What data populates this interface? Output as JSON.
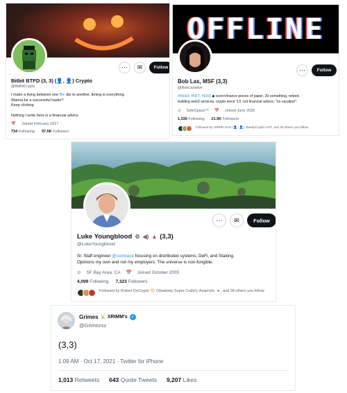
{
  "card1": {
    "name": "Bitbit BTFD (3, 3) (👤, 👤) Crypto",
    "handle": "@BitBitCrypto",
    "bio_lines": [
      "I make a living between one ",
      "Btc",
      " dip to another, timing is everything.",
      "Wanna be a successful trader?",
      "Keep clicking.",
      "-",
      "Nothing I write here is a financial advice"
    ],
    "joined": "Joined February 2017",
    "following_count": "734",
    "following_label": "Following",
    "followers_count": "97.5K",
    "followers_label": "Followers",
    "follow_label": "Follow",
    "more_icon": "more-icon"
  },
  "card2": {
    "banner_text": "OFFLINE",
    "name": "Bob Lax, MSF (3,3)",
    "handle": "@BobLaxative",
    "bio_tags": "#Web3, #NFT, #ENS",
    "bio_line1_rest": " econ+finance pieces of paper, 20-something, retired,",
    "bio_line2": "building web3 services. crypto since '13. not financial advice, \"on vacation\".",
    "location": "SafeSpace™",
    "joined": "Joined June 2020",
    "following_count": "1,336",
    "following_label": "Following",
    "followers_count": "21.9K",
    "followers_label": "Followers",
    "followed_by": "Followed by OREIR DAO (👤, 👤), BarelyCryptic.UST, and 28 others you follow",
    "follow_label": "Follow"
  },
  "card3": {
    "name": "Luke Youngblood",
    "name_suffix": "(3,3)",
    "handle": "@LukeYoungblood",
    "bio_pre": "Sr. Staff engineer ",
    "bio_link": "@coinbase",
    "bio_post": " focusing on distributed systems, DeFi, and Staking.",
    "bio_line2": "Opinions my own and not my employers. The universe is non-fungible.",
    "location": "SF Bay Area, CA",
    "joined": "Joined October 2009",
    "following_count": "4,099",
    "following_label": "Following",
    "followers_count": "7,323",
    "followers_label": "Followers",
    "followed_by": "Followed by Robert DeCrypto 🌕 (Shadowy Super Coder), Avaprotic 🔺, and 38 others you follow",
    "follow_label": "Follow"
  },
  "tweet": {
    "name": "Grimes",
    "name_suffix": "XRIMM's",
    "handle": "@Grimezsz",
    "text": "(3,3)",
    "time": "1:09 AM · Oct 17, 2021 · Twitter for iPhone",
    "retweets_count": "1,013",
    "retweets_label": "Retweets",
    "quotes_count": "643",
    "quotes_label": "Quote Tweets",
    "likes_count": "9,207",
    "likes_label": "Likes"
  },
  "colors": {
    "accent": "#1d9bf0",
    "text": "#0f1419",
    "muted": "#536471",
    "follow_bg": "#0f1419"
  }
}
